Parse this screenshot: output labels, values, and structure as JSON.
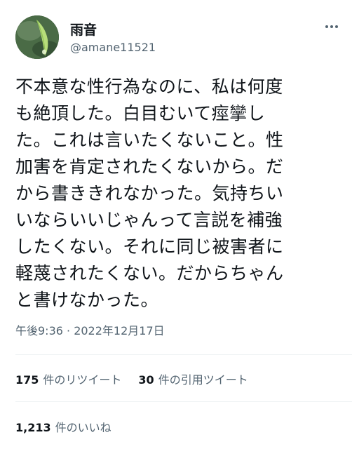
{
  "user": {
    "display_name": "雨音",
    "handle": "@amane11521",
    "avatar": "leaf-avatar"
  },
  "menu": {
    "icon": "more-icon"
  },
  "tweet": {
    "lines": [
      "不本意な性行為なのに、私は何度",
      "も絶頂した。白目むいて痙攣し",
      "た。これは言いたくないこと。性",
      "加害を肯定されたくないから。だ",
      "から書ききれなかった。気持ちい",
      "いならいいじゃんって言説を補強",
      "したくない。それに同じ被害者に",
      "軽蔑されたくない。だからちゃん",
      "と書けなかった。"
    ],
    "timestamp": "午後9:36 · 2022年12月17日"
  },
  "stats": {
    "retweets_count": "175",
    "retweets_label": "件のリツイート",
    "quotes_count": "30",
    "quotes_label": "件の引用ツイート",
    "likes_count": "1,213",
    "likes_label": "件のいいね"
  }
}
